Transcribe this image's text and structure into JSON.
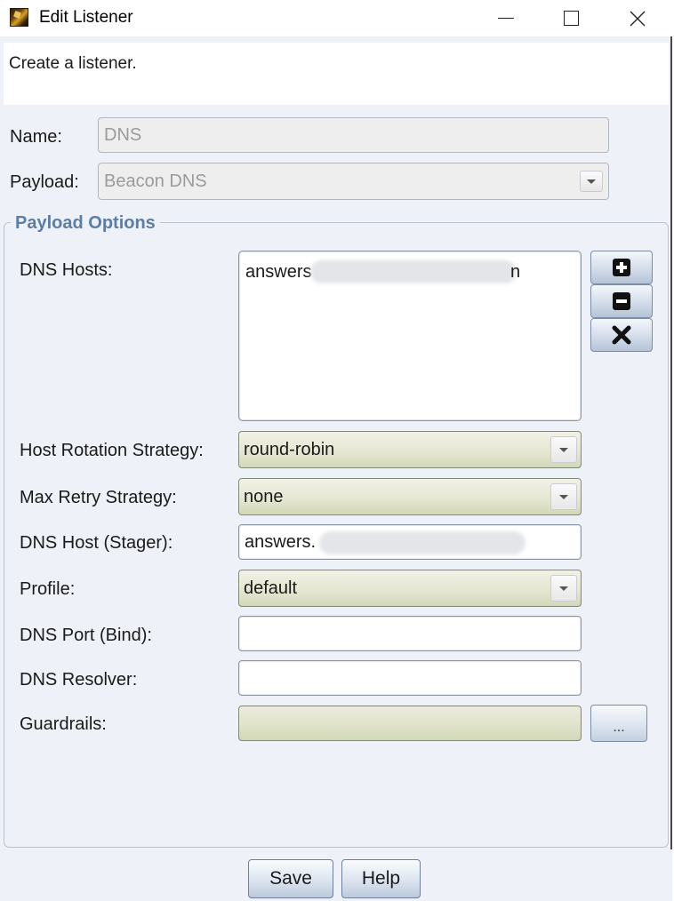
{
  "window": {
    "title": "Edit Listener",
    "app_icon": "cobalt-strike-icon",
    "controls": [
      "minimize-icon",
      "maximize-icon",
      "close-icon"
    ]
  },
  "description": "Create a listener.",
  "form": {
    "name_label": "Name:",
    "name_value": "DNS",
    "payload_label": "Payload:",
    "payload_value": "Beacon DNS"
  },
  "payload_options": {
    "title": "Payload Options",
    "dns_hosts_label": "DNS Hosts:",
    "dns_hosts": [
      "answers"
    ],
    "dns_hosts_suffix": "n",
    "host_buttons": [
      "plus-icon",
      "minus-icon",
      "x-icon"
    ],
    "host_rotation_label": "Host Rotation Strategy:",
    "host_rotation_value": "round-robin",
    "max_retry_label": "Max Retry Strategy:",
    "max_retry_value": "none",
    "stager_label": "DNS Host (Stager):",
    "stager_value": "answers.",
    "profile_label": "Profile:",
    "profile_value": "default",
    "port_label": "DNS Port (Bind):",
    "port_value": "",
    "resolver_label": "DNS Resolver:",
    "resolver_value": "",
    "guardrails_label": "Guardrails:",
    "guardrails_value": "",
    "guardrails_button": "..."
  },
  "buttons": {
    "save": "Save",
    "help": "Help"
  },
  "colors": {
    "group_title": "#5b7ea6",
    "combo_fill": "#e6e7d3",
    "dialog_background": "#eef1f7"
  }
}
